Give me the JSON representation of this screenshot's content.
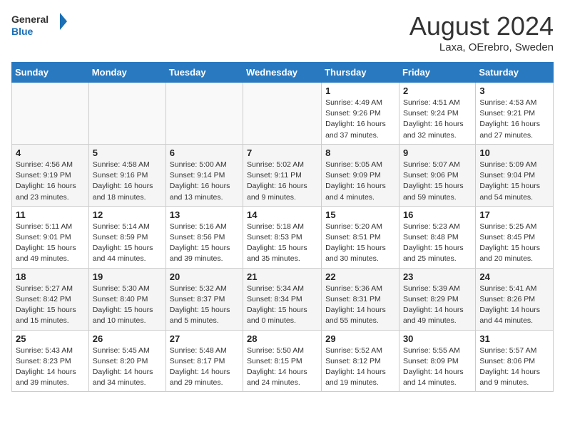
{
  "header": {
    "logo_general": "General",
    "logo_blue": "Blue",
    "title": "August 2024",
    "subtitle": "Laxa, OErebro, Sweden"
  },
  "weekdays": [
    "Sunday",
    "Monday",
    "Tuesday",
    "Wednesday",
    "Thursday",
    "Friday",
    "Saturday"
  ],
  "weeks": [
    [
      {
        "day": "",
        "info": ""
      },
      {
        "day": "",
        "info": ""
      },
      {
        "day": "",
        "info": ""
      },
      {
        "day": "",
        "info": ""
      },
      {
        "day": "1",
        "info": "Sunrise: 4:49 AM\nSunset: 9:26 PM\nDaylight: 16 hours\nand 37 minutes."
      },
      {
        "day": "2",
        "info": "Sunrise: 4:51 AM\nSunset: 9:24 PM\nDaylight: 16 hours\nand 32 minutes."
      },
      {
        "day": "3",
        "info": "Sunrise: 4:53 AM\nSunset: 9:21 PM\nDaylight: 16 hours\nand 27 minutes."
      }
    ],
    [
      {
        "day": "4",
        "info": "Sunrise: 4:56 AM\nSunset: 9:19 PM\nDaylight: 16 hours\nand 23 minutes."
      },
      {
        "day": "5",
        "info": "Sunrise: 4:58 AM\nSunset: 9:16 PM\nDaylight: 16 hours\nand 18 minutes."
      },
      {
        "day": "6",
        "info": "Sunrise: 5:00 AM\nSunset: 9:14 PM\nDaylight: 16 hours\nand 13 minutes."
      },
      {
        "day": "7",
        "info": "Sunrise: 5:02 AM\nSunset: 9:11 PM\nDaylight: 16 hours\nand 9 minutes."
      },
      {
        "day": "8",
        "info": "Sunrise: 5:05 AM\nSunset: 9:09 PM\nDaylight: 16 hours\nand 4 minutes."
      },
      {
        "day": "9",
        "info": "Sunrise: 5:07 AM\nSunset: 9:06 PM\nDaylight: 15 hours\nand 59 minutes."
      },
      {
        "day": "10",
        "info": "Sunrise: 5:09 AM\nSunset: 9:04 PM\nDaylight: 15 hours\nand 54 minutes."
      }
    ],
    [
      {
        "day": "11",
        "info": "Sunrise: 5:11 AM\nSunset: 9:01 PM\nDaylight: 15 hours\nand 49 minutes."
      },
      {
        "day": "12",
        "info": "Sunrise: 5:14 AM\nSunset: 8:59 PM\nDaylight: 15 hours\nand 44 minutes."
      },
      {
        "day": "13",
        "info": "Sunrise: 5:16 AM\nSunset: 8:56 PM\nDaylight: 15 hours\nand 39 minutes."
      },
      {
        "day": "14",
        "info": "Sunrise: 5:18 AM\nSunset: 8:53 PM\nDaylight: 15 hours\nand 35 minutes."
      },
      {
        "day": "15",
        "info": "Sunrise: 5:20 AM\nSunset: 8:51 PM\nDaylight: 15 hours\nand 30 minutes."
      },
      {
        "day": "16",
        "info": "Sunrise: 5:23 AM\nSunset: 8:48 PM\nDaylight: 15 hours\nand 25 minutes."
      },
      {
        "day": "17",
        "info": "Sunrise: 5:25 AM\nSunset: 8:45 PM\nDaylight: 15 hours\nand 20 minutes."
      }
    ],
    [
      {
        "day": "18",
        "info": "Sunrise: 5:27 AM\nSunset: 8:42 PM\nDaylight: 15 hours\nand 15 minutes."
      },
      {
        "day": "19",
        "info": "Sunrise: 5:30 AM\nSunset: 8:40 PM\nDaylight: 15 hours\nand 10 minutes."
      },
      {
        "day": "20",
        "info": "Sunrise: 5:32 AM\nSunset: 8:37 PM\nDaylight: 15 hours\nand 5 minutes."
      },
      {
        "day": "21",
        "info": "Sunrise: 5:34 AM\nSunset: 8:34 PM\nDaylight: 15 hours\nand 0 minutes."
      },
      {
        "day": "22",
        "info": "Sunrise: 5:36 AM\nSunset: 8:31 PM\nDaylight: 14 hours\nand 55 minutes."
      },
      {
        "day": "23",
        "info": "Sunrise: 5:39 AM\nSunset: 8:29 PM\nDaylight: 14 hours\nand 49 minutes."
      },
      {
        "day": "24",
        "info": "Sunrise: 5:41 AM\nSunset: 8:26 PM\nDaylight: 14 hours\nand 44 minutes."
      }
    ],
    [
      {
        "day": "25",
        "info": "Sunrise: 5:43 AM\nSunset: 8:23 PM\nDaylight: 14 hours\nand 39 minutes."
      },
      {
        "day": "26",
        "info": "Sunrise: 5:45 AM\nSunset: 8:20 PM\nDaylight: 14 hours\nand 34 minutes."
      },
      {
        "day": "27",
        "info": "Sunrise: 5:48 AM\nSunset: 8:17 PM\nDaylight: 14 hours\nand 29 minutes."
      },
      {
        "day": "28",
        "info": "Sunrise: 5:50 AM\nSunset: 8:15 PM\nDaylight: 14 hours\nand 24 minutes."
      },
      {
        "day": "29",
        "info": "Sunrise: 5:52 AM\nSunset: 8:12 PM\nDaylight: 14 hours\nand 19 minutes."
      },
      {
        "day": "30",
        "info": "Sunrise: 5:55 AM\nSunset: 8:09 PM\nDaylight: 14 hours\nand 14 minutes."
      },
      {
        "day": "31",
        "info": "Sunrise: 5:57 AM\nSunset: 8:06 PM\nDaylight: 14 hours\nand 9 minutes."
      }
    ]
  ]
}
